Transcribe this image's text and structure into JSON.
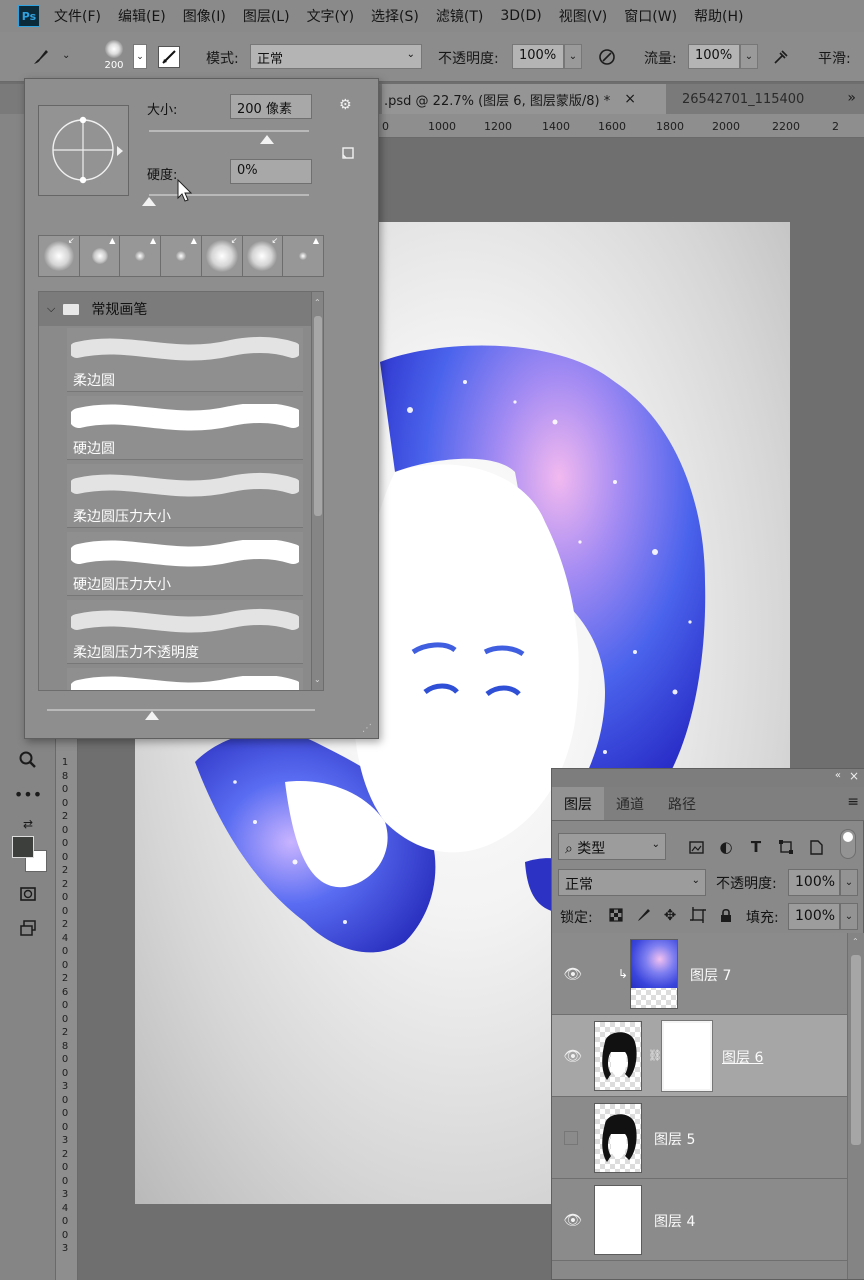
{
  "app": {
    "logo": "Ps"
  },
  "menu": [
    "文件(F)",
    "编辑(E)",
    "图像(I)",
    "图层(L)",
    "文字(Y)",
    "选择(S)",
    "滤镜(T)",
    "3D(D)",
    "视图(V)",
    "窗口(W)",
    "帮助(H)"
  ],
  "options": {
    "brush_size_preview": "200",
    "mode_label": "模式:",
    "mode_value": "正常",
    "opacity_label": "不透明度:",
    "opacity_value": "100%",
    "flow_label": "流量:",
    "flow_value": "100%",
    "smoothing_label": "平滑:"
  },
  "tabs": [
    {
      "label": ".psd @ 22.7% (图层 6, 图层蒙版/8) *",
      "active": true,
      "close": "×"
    },
    {
      "label": "26542701_115400",
      "active": false
    }
  ],
  "tabs_overflow": "»",
  "ruler_top": [
    "0",
    "1000",
    "1200",
    "1400",
    "1600",
    "1800",
    "2000",
    "2200",
    "2"
  ],
  "ruler_left": [
    "1",
    "8",
    "0",
    "0",
    "2",
    "0",
    "0",
    "0",
    "2",
    "2",
    "0",
    "0",
    "2",
    "4",
    "0",
    "0",
    "2",
    "6",
    "0",
    "0",
    "2",
    "8",
    "0",
    "0",
    "3",
    "0",
    "0",
    "0",
    "3",
    "2",
    "0",
    "0",
    "3",
    "4",
    "0",
    "0",
    "3"
  ],
  "brush_picker": {
    "size_label": "大小:",
    "size_value": "200 像素",
    "size_fraction": 0.74,
    "hardness_label": "硬度:",
    "hardness_value": "0%",
    "hardness_fraction": 0.0,
    "gear_icon": "gear-icon",
    "new_preset_icon": "new-preset-icon",
    "group_name": "常规画笔",
    "brushes": [
      {
        "name": "柔边圆",
        "style": "soft"
      },
      {
        "name": "硬边圆",
        "style": "hard"
      },
      {
        "name": "柔边圆压力大小",
        "style": "soft"
      },
      {
        "name": "硬边圆压力大小",
        "style": "hard"
      },
      {
        "name": "柔边圆压力不透明度",
        "style": "soft"
      },
      {
        "name": "",
        "style": "hard"
      }
    ],
    "preview_slider_fraction": 0.39
  },
  "layers": {
    "tabs": [
      "图层",
      "通道",
      "路径"
    ],
    "filter_label": "类型",
    "blend_mode": "正常",
    "opacity_label": "不透明度:",
    "opacity_value": "100%",
    "lock_label": "锁定:",
    "fill_label": "填充:",
    "fill_value": "100%",
    "items": [
      {
        "name": "图层 7",
        "visible": true,
        "selected": false,
        "thumb": "galaxy",
        "clipped": true
      },
      {
        "name": "图层 6",
        "visible": true,
        "selected": true,
        "thumb": "portrait",
        "mask": true
      },
      {
        "name": "图层 5",
        "visible": false,
        "selected": false,
        "thumb": "portrait"
      },
      {
        "name": "图层 4",
        "visible": true,
        "selected": false,
        "thumb": "white"
      }
    ]
  },
  "colors": {
    "ui_bg": "#8e8e8e",
    "accent_blue": "#3b5bea",
    "accent_pink": "#e6a8e8"
  }
}
